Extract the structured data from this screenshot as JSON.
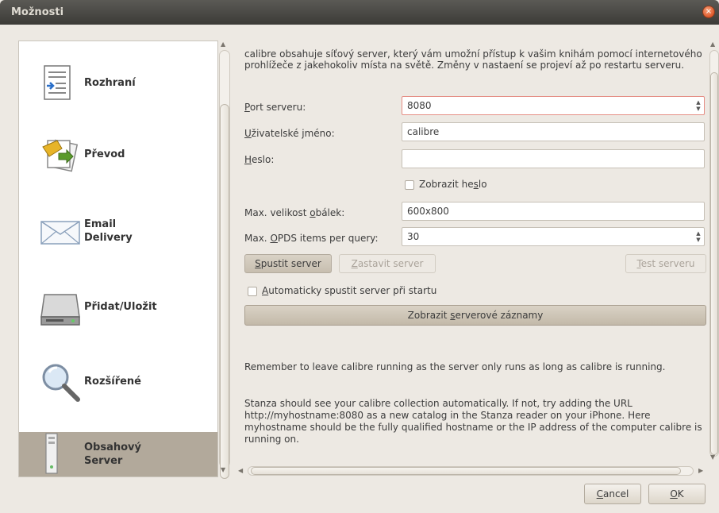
{
  "window": {
    "title": "Možnosti",
    "close_glyph": "×"
  },
  "sidebar": {
    "items": [
      {
        "label_l1": "Rozhraní",
        "label_l2": "",
        "icon": "interface-icon"
      },
      {
        "label_l1": "Převod",
        "label_l2": "",
        "icon": "conversion-icon"
      },
      {
        "label_l1": "Email",
        "label_l2": "Delivery",
        "icon": "envelope-icon"
      },
      {
        "label_l1": "Přidat/Uložit",
        "label_l2": "",
        "icon": "hard-drive-icon"
      },
      {
        "label_l1": "Rozšířené",
        "label_l2": "",
        "icon": "magnifier-icon"
      },
      {
        "label_l1": "Obsahový",
        "label_l2": "Server",
        "icon": "server-icon",
        "selected": true
      }
    ]
  },
  "server": {
    "description": "calibre obsahuje síťový server, který vám umožní přístup k vašim knihám pomocí internetového prohlížeče z jakehokoliv místa na světě. Změny v nastaení se projeví až po restartu serveru.",
    "port_label": {
      "pre": "",
      "accel": "P",
      "post": "ort serveru:"
    },
    "port_value": "8080",
    "username_label": {
      "pre": "",
      "accel": "U",
      "post": "živatelské jméno:"
    },
    "username_value": "calibre",
    "password_label": {
      "pre": "",
      "accel": "H",
      "post": "eslo:"
    },
    "password_value": "",
    "show_password_label": {
      "pre": "Zobrazit he",
      "accel": "s",
      "post": "lo"
    },
    "show_password_checked": false,
    "cover_size_label": {
      "pre": "Max. velikost ",
      "accel": "o",
      "post": "bálek:"
    },
    "cover_size_value": "600x800",
    "opds_label": {
      "pre": "Max. ",
      "accel": "O",
      "post": "PDS items per query:"
    },
    "opds_value": "30",
    "start_button": {
      "pre": "",
      "accel": "S",
      "post": "pustit server"
    },
    "stop_button": {
      "pre": "",
      "accel": "Z",
      "post": "astavit server"
    },
    "test_button": {
      "pre": "",
      "accel": "T",
      "post": "est serveru"
    },
    "autostart_label": {
      "pre": "",
      "accel": "A",
      "post": "utomaticky spustit server při startu"
    },
    "autostart_checked": false,
    "logs_button": {
      "pre": "Zobrazit ",
      "accel": "s",
      "post": "erverové záznamy"
    },
    "note1": "Remember to leave calibre running as the server only runs as long as calibre is running.",
    "note2": "Stanza should see your calibre collection automatically. If not, try adding the URL http://myhostname:8080 as a new catalog in the Stanza reader on your iPhone. Here myhostname should be the fully qualified hostname or the IP address of the computer calibre is running on."
  },
  "footer": {
    "cancel": {
      "pre": "",
      "accel": "C",
      "post": "ancel"
    },
    "ok": {
      "pre": "",
      "accel": "O",
      "post": "K"
    }
  },
  "colors": {
    "selected_bg": "#b2a99b",
    "titlebar": "#3c3b37",
    "close": "#e0582a"
  }
}
